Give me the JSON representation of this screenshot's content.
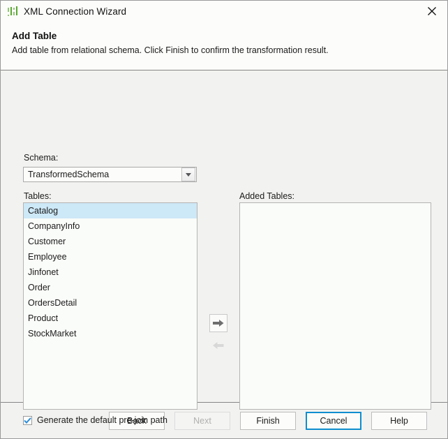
{
  "window": {
    "title": "XML Connection Wizard",
    "icon": "bar-chart-icon",
    "close_icon": "close-icon"
  },
  "header": {
    "title": "Add Table",
    "description": "Add table from relational schema. Click Finish to confirm the transformation result."
  },
  "schema": {
    "label": "Schema:",
    "value": "TransformedSchema",
    "dropdown_icon": "chevron-down-icon"
  },
  "tables": {
    "label": "Tables:",
    "items": [
      "Catalog",
      "CompanyInfo",
      "Customer",
      "Employee",
      "Jinfonet",
      "Order",
      "OrdersDetail",
      "Product",
      "StockMarket"
    ],
    "selected_index": 0,
    "selection_color": "#cde8f7"
  },
  "added_tables": {
    "label": "Added Tables:",
    "items": []
  },
  "transfer": {
    "add_icon": "arrow-right-icon",
    "add_enabled": true,
    "remove_icon": "arrow-left-icon",
    "remove_enabled": false
  },
  "options": {
    "prejoin": {
      "label": "Generate the default pre-join path",
      "checked": true,
      "check_color": "#2f8fd8"
    }
  },
  "footer": {
    "buttons": [
      {
        "label": "Back",
        "state": "normal"
      },
      {
        "label": "Next",
        "state": "disabled"
      },
      {
        "label": "Finish",
        "state": "normal"
      },
      {
        "label": "Cancel",
        "state": "focused"
      },
      {
        "label": "Help",
        "state": "normal"
      }
    ],
    "focus_color": "#0d8ecf"
  }
}
